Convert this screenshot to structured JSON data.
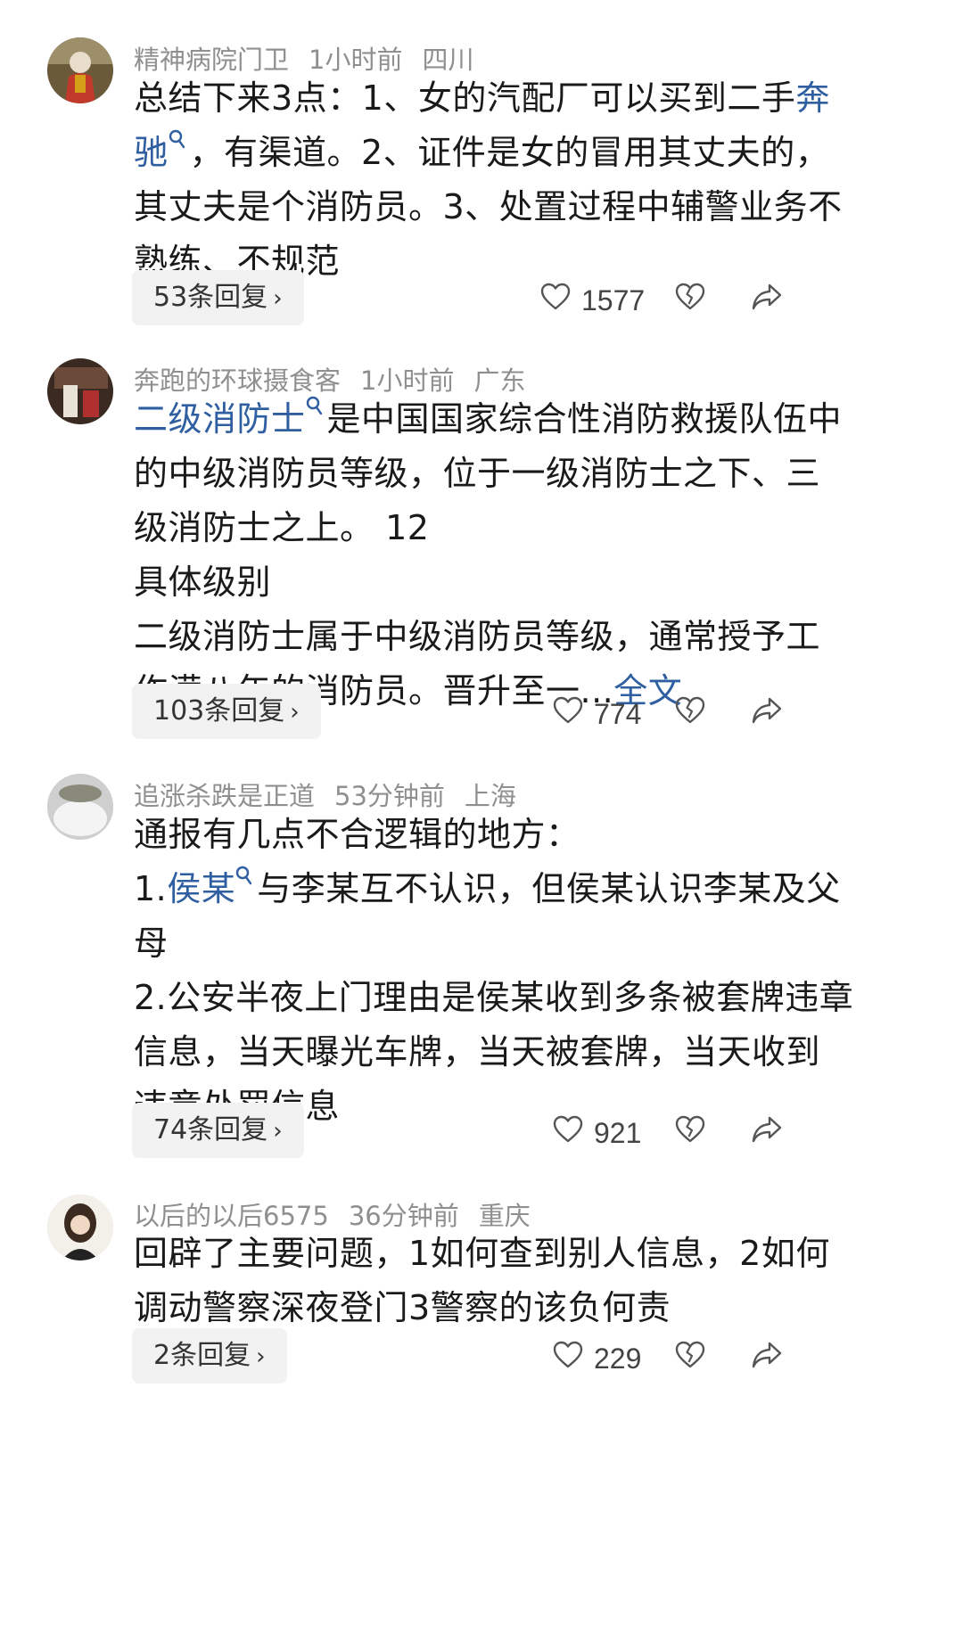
{
  "comments": [
    {
      "username": "精神病院门卫",
      "time": "1小时前",
      "location": "四川",
      "lines": [
        [
          {
            "t": "总结下来3点：1、女的汽配厂可以买到二手"
          },
          {
            "t": "奔",
            "link": true
          }
        ],
        [
          {
            "t": "驰",
            "link": true,
            "icon": true
          },
          {
            "t": "，有渠道。2、证件是女的冒用其丈夫的，"
          }
        ],
        [
          {
            "t": "其丈夫是个消防员。3、处置过程中辅警业务不"
          }
        ],
        [
          {
            "t": "熟练、不规范"
          }
        ]
      ],
      "replies": "53条回复",
      "likes": "1577"
    },
    {
      "username": "奔跑的环球摄食客",
      "time": "1小时前",
      "location": "广东",
      "lines": [
        [
          {
            "t": "二级消防士",
            "link": true,
            "icon": true
          },
          {
            "t": "是中国国家综合性消防救援队伍中"
          }
        ],
        [
          {
            "t": "的中级消防员等级，位于一级消防士之下、三"
          }
        ],
        [
          {
            "t": "级消防士之上。  12"
          }
        ],
        [
          {
            "t": "具体级别"
          }
        ],
        [
          {
            "t": "二级消防士属于中级消防员等级，通常授予工"
          }
        ],
        [
          {
            "t": "作满八年的消防员。晋升至一..."
          },
          {
            "t": "全文",
            "link": true
          }
        ]
      ],
      "replies": "103条回复",
      "likes": "774"
    },
    {
      "username": "追涨杀跌是正道",
      "time": "53分钟前",
      "location": "上海",
      "lines": [
        [
          {
            "t": "通报有几点不合逻辑的地方："
          }
        ],
        [
          {
            "t": "1."
          },
          {
            "t": "侯某",
            "link": true,
            "icon": true
          },
          {
            "t": "与李某互不认识，但侯某认识李某及父"
          }
        ],
        [
          {
            "t": "母"
          }
        ],
        [
          {
            "t": "2.公安半夜上门理由是侯某收到多条被套牌违章"
          }
        ],
        [
          {
            "t": "信息，当天曝光车牌，当天被套牌，当天收到"
          }
        ],
        [
          {
            "t": "违章处罚信息"
          }
        ]
      ],
      "replies": "74条回复",
      "likes": "921"
    },
    {
      "username": "以后的以后6575",
      "time": "36分钟前",
      "location": "重庆",
      "lines": [
        [
          {
            "t": "回辟了主要问题，1如何查到别人信息，2如何"
          }
        ],
        [
          {
            "t": "调动警察深夜登门3警察的该负何责"
          }
        ]
      ],
      "replies": "2条回复",
      "likes": "229"
    }
  ]
}
